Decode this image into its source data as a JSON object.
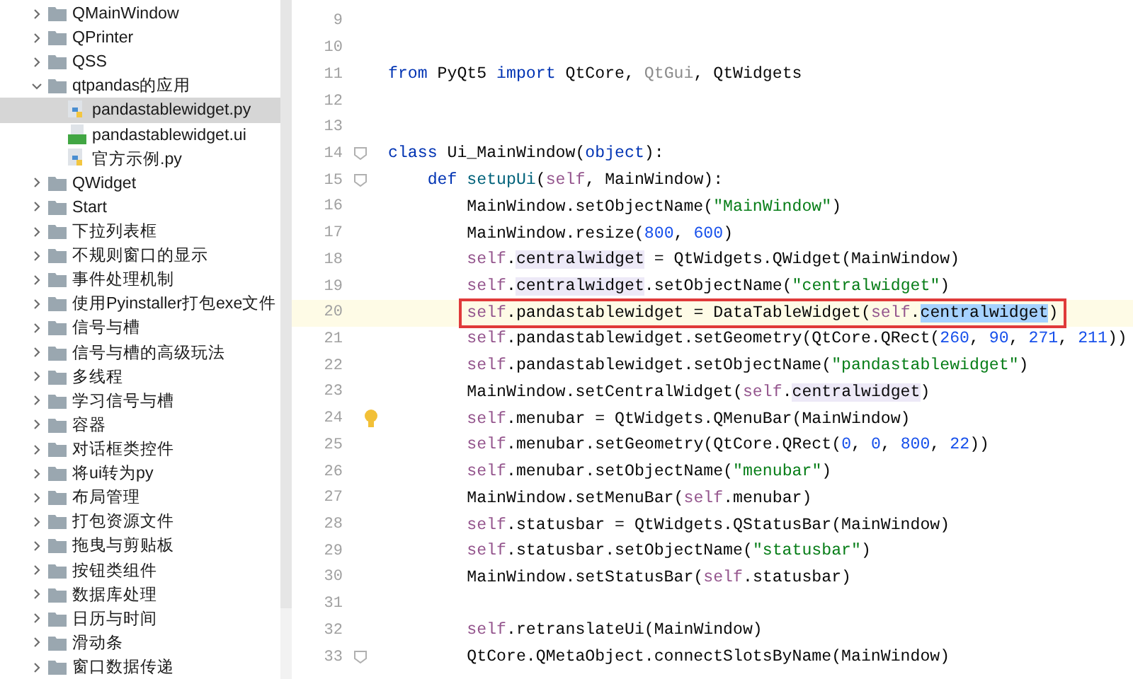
{
  "project_tree": {
    "items": [
      {
        "label": "QMainWindow",
        "kind": "folder",
        "expanded": false,
        "selected": false
      },
      {
        "label": "QPrinter",
        "kind": "folder",
        "expanded": false,
        "selected": false
      },
      {
        "label": "QSS",
        "kind": "folder",
        "expanded": false,
        "selected": false
      },
      {
        "label": "qtpandas的应用",
        "kind": "folder",
        "expanded": true,
        "selected": false,
        "children": [
          {
            "label": "pandastablewidget.py",
            "kind": "python",
            "selected": true
          },
          {
            "label": "pandastablewidget.ui",
            "kind": "ui",
            "selected": false
          },
          {
            "label": "官方示例.py",
            "kind": "python",
            "selected": false
          }
        ]
      },
      {
        "label": "QWidget",
        "kind": "folder",
        "expanded": false,
        "selected": false
      },
      {
        "label": "Start",
        "kind": "folder",
        "expanded": false,
        "selected": false
      },
      {
        "label": "下拉列表框",
        "kind": "folder",
        "expanded": false,
        "selected": false
      },
      {
        "label": "不规则窗口的显示",
        "kind": "folder",
        "expanded": false,
        "selected": false
      },
      {
        "label": "事件处理机制",
        "kind": "folder",
        "expanded": false,
        "selected": false
      },
      {
        "label": "使用Pyinstaller打包exe文件",
        "kind": "folder",
        "expanded": false,
        "selected": false
      },
      {
        "label": "信号与槽",
        "kind": "folder",
        "expanded": false,
        "selected": false
      },
      {
        "label": "信号与槽的高级玩法",
        "kind": "folder",
        "expanded": false,
        "selected": false
      },
      {
        "label": "多线程",
        "kind": "folder",
        "expanded": false,
        "selected": false
      },
      {
        "label": "学习信号与槽",
        "kind": "folder",
        "expanded": false,
        "selected": false
      },
      {
        "label": "容器",
        "kind": "folder",
        "expanded": false,
        "selected": false
      },
      {
        "label": "对话框类控件",
        "kind": "folder",
        "expanded": false,
        "selected": false
      },
      {
        "label": "将ui转为py",
        "kind": "folder",
        "expanded": false,
        "selected": false
      },
      {
        "label": "布局管理",
        "kind": "folder",
        "expanded": false,
        "selected": false
      },
      {
        "label": "打包资源文件",
        "kind": "folder",
        "expanded": false,
        "selected": false
      },
      {
        "label": "拖曳与剪贴板",
        "kind": "folder",
        "expanded": false,
        "selected": false
      },
      {
        "label": "按钮类组件",
        "kind": "folder",
        "expanded": false,
        "selected": false
      },
      {
        "label": "数据库处理",
        "kind": "folder",
        "expanded": false,
        "selected": false
      },
      {
        "label": "日历与时间",
        "kind": "folder",
        "expanded": false,
        "selected": false
      },
      {
        "label": "滑动条",
        "kind": "folder",
        "expanded": false,
        "selected": false
      },
      {
        "label": "窗口数据传递",
        "kind": "folder",
        "expanded": false,
        "selected": false
      }
    ]
  },
  "editor": {
    "lines": [
      {
        "number": "9"
      },
      {
        "number": "10"
      },
      {
        "number": "11",
        "tokens": [
          {
            "kind": "kw",
            "text": "from"
          },
          {
            "kind": "plain",
            "text": " PyQt5 "
          },
          {
            "kind": "kw",
            "text": "import"
          },
          {
            "kind": "plain",
            "text": " QtCore, "
          },
          {
            "kind": "dim",
            "text": "QtGui"
          },
          {
            "kind": "plain",
            "text": ", QtWidgets"
          }
        ]
      },
      {
        "number": "12"
      },
      {
        "number": "13"
      },
      {
        "number": "14",
        "fold": true,
        "tokens": [
          {
            "kind": "kw",
            "text": "class"
          },
          {
            "kind": "plain",
            "text": " Ui_MainWindow("
          },
          {
            "kind": "kw",
            "text": "object"
          },
          {
            "kind": "plain",
            "text": "):"
          }
        ]
      },
      {
        "number": "15",
        "fold": true,
        "tokens": [
          {
            "kind": "kw",
            "text": "    def"
          },
          {
            "kind": "fn",
            "text": " setupUi"
          },
          {
            "kind": "plain",
            "text": "("
          },
          {
            "kind": "self",
            "text": "self"
          },
          {
            "kind": "plain",
            "text": ", MainWindow):"
          }
        ]
      },
      {
        "number": "16",
        "tokens": [
          {
            "kind": "plain",
            "text": "        MainWindow.setObjectName("
          },
          {
            "kind": "str",
            "text": "\"MainWindow\""
          },
          {
            "kind": "plain",
            "text": ")"
          }
        ]
      },
      {
        "number": "17",
        "tokens": [
          {
            "kind": "plain",
            "text": "        MainWindow.resize("
          },
          {
            "kind": "num",
            "text": "800"
          },
          {
            "kind": "plain",
            "text": ", "
          },
          {
            "kind": "num",
            "text": "600"
          },
          {
            "kind": "plain",
            "text": ")"
          }
        ]
      },
      {
        "number": "18",
        "tokens": [
          {
            "kind": "self",
            "text": "        self"
          },
          {
            "kind": "plain",
            "text": "."
          },
          {
            "kind": "ref",
            "text": "centralwidget"
          },
          {
            "kind": "plain",
            "text": " = QtWidgets.QWidget(MainWindow)"
          }
        ]
      },
      {
        "number": "19",
        "tokens": [
          {
            "kind": "self",
            "text": "        self"
          },
          {
            "kind": "plain",
            "text": "."
          },
          {
            "kind": "ref",
            "text": "centralwidget"
          },
          {
            "kind": "plain",
            "text": ".setObjectName("
          },
          {
            "kind": "str",
            "text": "\"centralwidget\""
          },
          {
            "kind": "plain",
            "text": ")"
          }
        ]
      },
      {
        "number": "20",
        "current": true,
        "boxed": true,
        "tokens": [
          {
            "kind": "self",
            "text": "        self"
          },
          {
            "kind": "plain",
            "text": ".pandastablewidget = DataTableWidget("
          },
          {
            "kind": "self",
            "text": "self"
          },
          {
            "kind": "plain",
            "text": "."
          },
          {
            "kind": "sel",
            "text": "centralwidget"
          },
          {
            "kind": "plain",
            "text": ")"
          }
        ]
      },
      {
        "number": "21",
        "tokens": [
          {
            "kind": "self",
            "text": "        self"
          },
          {
            "kind": "plain",
            "text": ".pandastablewidget.setGeometry(QtCore.QRect("
          },
          {
            "kind": "num",
            "text": "260"
          },
          {
            "kind": "plain",
            "text": ", "
          },
          {
            "kind": "num",
            "text": "90"
          },
          {
            "kind": "plain",
            "text": ", "
          },
          {
            "kind": "num",
            "text": "271"
          },
          {
            "kind": "plain",
            "text": ", "
          },
          {
            "kind": "num",
            "text": "211"
          },
          {
            "kind": "plain",
            "text": "))"
          }
        ]
      },
      {
        "number": "22",
        "tokens": [
          {
            "kind": "self",
            "text": "        self"
          },
          {
            "kind": "plain",
            "text": ".pandastablewidget.setObjectName("
          },
          {
            "kind": "str",
            "text": "\"pandastablewidget\""
          },
          {
            "kind": "plain",
            "text": ")"
          }
        ]
      },
      {
        "number": "23",
        "tokens": [
          {
            "kind": "plain",
            "text": "        MainWindow.setCentralWidget("
          },
          {
            "kind": "self",
            "text": "self"
          },
          {
            "kind": "plain",
            "text": "."
          },
          {
            "kind": "ref",
            "text": "centralwidget"
          },
          {
            "kind": "plain",
            "text": ")"
          }
        ]
      },
      {
        "number": "24",
        "hint": true,
        "tokens": [
          {
            "kind": "self",
            "text": "        self"
          },
          {
            "kind": "plain",
            "text": ".menubar = QtWidgets.QMenuBar(MainWindow)"
          }
        ]
      },
      {
        "number": "25",
        "tokens": [
          {
            "kind": "self",
            "text": "        self"
          },
          {
            "kind": "plain",
            "text": ".menubar.setGeometry(QtCore.QRect("
          },
          {
            "kind": "num",
            "text": "0"
          },
          {
            "kind": "plain",
            "text": ", "
          },
          {
            "kind": "num",
            "text": "0"
          },
          {
            "kind": "plain",
            "text": ", "
          },
          {
            "kind": "num",
            "text": "800"
          },
          {
            "kind": "plain",
            "text": ", "
          },
          {
            "kind": "num",
            "text": "22"
          },
          {
            "kind": "plain",
            "text": "))"
          }
        ]
      },
      {
        "number": "26",
        "tokens": [
          {
            "kind": "self",
            "text": "        self"
          },
          {
            "kind": "plain",
            "text": ".menubar.setObjectName("
          },
          {
            "kind": "str",
            "text": "\"menubar\""
          },
          {
            "kind": "plain",
            "text": ")"
          }
        ]
      },
      {
        "number": "27",
        "tokens": [
          {
            "kind": "plain",
            "text": "        MainWindow.setMenuBar("
          },
          {
            "kind": "self",
            "text": "self"
          },
          {
            "kind": "plain",
            "text": ".menubar)"
          }
        ]
      },
      {
        "number": "28",
        "tokens": [
          {
            "kind": "self",
            "text": "        self"
          },
          {
            "kind": "plain",
            "text": ".statusbar = QtWidgets.QStatusBar(MainWindow)"
          }
        ]
      },
      {
        "number": "29",
        "tokens": [
          {
            "kind": "self",
            "text": "        self"
          },
          {
            "kind": "plain",
            "text": ".statusbar.setObjectName("
          },
          {
            "kind": "str",
            "text": "\"statusbar\""
          },
          {
            "kind": "plain",
            "text": ")"
          }
        ]
      },
      {
        "number": "30",
        "tokens": [
          {
            "kind": "plain",
            "text": "        MainWindow.setStatusBar("
          },
          {
            "kind": "self",
            "text": "self"
          },
          {
            "kind": "plain",
            "text": ".statusbar)"
          }
        ]
      },
      {
        "number": "31"
      },
      {
        "number": "32",
        "tokens": [
          {
            "kind": "self",
            "text": "        self"
          },
          {
            "kind": "plain",
            "text": ".retranslateUi(MainWindow)"
          }
        ]
      },
      {
        "number": "33",
        "fold": true,
        "tokens": [
          {
            "kind": "plain",
            "text": "        QtCore.QMetaObject.connectSlotsByName(MainWindow)"
          }
        ]
      }
    ]
  }
}
